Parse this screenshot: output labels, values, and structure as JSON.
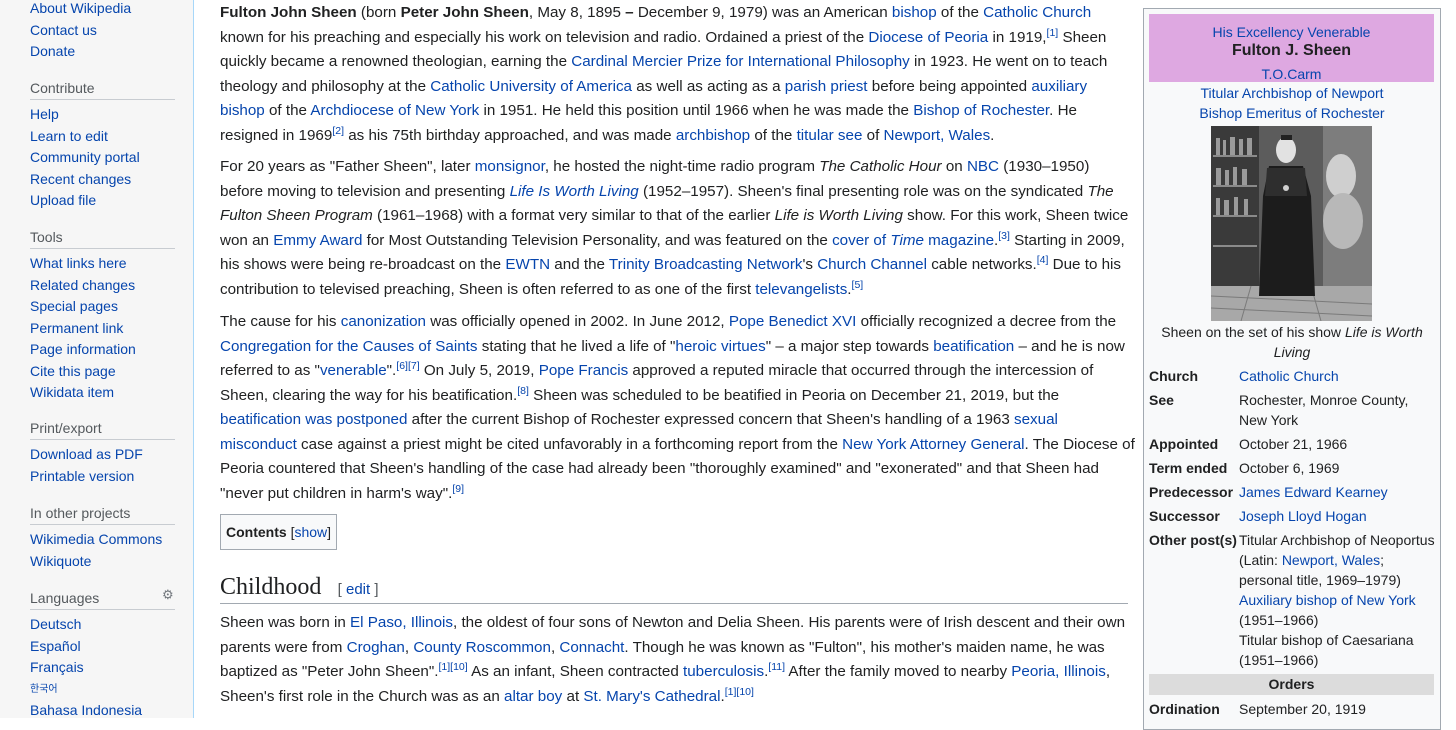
{
  "sidebar": {
    "top_links": [
      "About Wikipedia",
      "Contact us",
      "Donate"
    ],
    "contribute": {
      "heading": "Contribute",
      "links": [
        "Help",
        "Learn to edit",
        "Community portal",
        "Recent changes",
        "Upload file"
      ]
    },
    "tools": {
      "heading": "Tools",
      "links": [
        "What links here",
        "Related changes",
        "Special pages",
        "Permanent link",
        "Page information",
        "Cite this page",
        "Wikidata item"
      ]
    },
    "print": {
      "heading": "Print/export",
      "links": [
        "Download as PDF",
        "Printable version"
      ]
    },
    "projects": {
      "heading": "In other projects",
      "links": [
        "Wikimedia Commons",
        "Wikiquote"
      ]
    },
    "languages": {
      "heading": "Languages",
      "links": [
        "Deutsch",
        "Español",
        "Français",
        "한국어",
        "Bahasa Indonesia"
      ]
    }
  },
  "article": {
    "paragraphs": [
      [
        {
          "t": "Fulton John Sheen",
          "b": true
        },
        {
          "t": " (born "
        },
        {
          "t": "Peter John Sheen",
          "b": true
        },
        {
          "t": ", May 8, 1895 "
        },
        {
          "t": "–",
          "b": true
        },
        {
          "t": " December 9, 1979) was an American "
        },
        {
          "t": "bishop",
          "l": true
        },
        {
          "t": " of the "
        },
        {
          "t": "Catholic Church",
          "l": true
        },
        {
          "t": " known for his preaching and especially his work on television and radio. Ordained a priest of the "
        },
        {
          "t": "Diocese of Peoria",
          "l": true
        },
        {
          "t": " in 1919,"
        },
        {
          "t": "[1]",
          "s": true
        },
        {
          "t": " Sheen quickly became a renowned theologian, earning the "
        },
        {
          "t": "Cardinal Mercier Prize for International Philosophy",
          "l": true
        },
        {
          "t": " in 1923. He went on to teach theology and philosophy at the "
        },
        {
          "t": "Catholic University of America",
          "l": true
        },
        {
          "t": " as well as acting as a "
        },
        {
          "t": "parish priest",
          "l": true
        },
        {
          "t": " before being appointed "
        },
        {
          "t": "auxiliary bishop",
          "l": true
        },
        {
          "t": " of the "
        },
        {
          "t": "Archdiocese of New York",
          "l": true
        },
        {
          "t": " in 1951. He held this position until 1966 when he was made the "
        },
        {
          "t": "Bishop of Rochester",
          "l": true
        },
        {
          "t": ". He resigned in 1969"
        },
        {
          "t": "[2]",
          "s": true
        },
        {
          "t": " as his 75th birthday approached, and was made "
        },
        {
          "t": "archbishop",
          "l": true
        },
        {
          "t": " of the "
        },
        {
          "t": "titular see",
          "l": true
        },
        {
          "t": " of "
        },
        {
          "t": "Newport, Wales",
          "l": true
        },
        {
          "t": "."
        }
      ],
      [
        {
          "t": "For 20 years as \"Father Sheen\", later "
        },
        {
          "t": "monsignor",
          "l": true
        },
        {
          "t": ", he hosted the night-time radio program "
        },
        {
          "t": "The Catholic Hour",
          "i": true
        },
        {
          "t": " on "
        },
        {
          "t": "NBC",
          "l": true
        },
        {
          "t": " (1930–1950) before moving to television and presenting "
        },
        {
          "t": "Life Is Worth Living",
          "l": true,
          "i": true
        },
        {
          "t": " (1952–1957). Sheen's final presenting role was on the syndicated "
        },
        {
          "t": "The Fulton Sheen Program",
          "i": true
        },
        {
          "t": " (1961–1968) with a format very similar to that of the earlier "
        },
        {
          "t": "Life is Worth Living",
          "i": true
        },
        {
          "t": " show. For this work, Sheen twice won an "
        },
        {
          "t": "Emmy Award",
          "l": true
        },
        {
          "t": " for Most Outstanding Television Personality, and was featured on the "
        },
        {
          "t": "cover of ",
          "l": true
        },
        {
          "t": "Time",
          "l": true,
          "i": true
        },
        {
          "t": " magazine",
          "l": true
        },
        {
          "t": "."
        },
        {
          "t": "[3]",
          "s": true
        },
        {
          "t": " Starting in 2009, his shows were being re-broadcast on the "
        },
        {
          "t": "EWTN",
          "l": true
        },
        {
          "t": " and the "
        },
        {
          "t": "Trinity Broadcasting Network",
          "l": true
        },
        {
          "t": "'s "
        },
        {
          "t": "Church Channel",
          "l": true
        },
        {
          "t": " cable networks."
        },
        {
          "t": "[4]",
          "s": true
        },
        {
          "t": " Due to his contribution to televised preaching, Sheen is often referred to as one of the first "
        },
        {
          "t": "televangelists",
          "l": true
        },
        {
          "t": "."
        },
        {
          "t": "[5]",
          "s": true
        }
      ],
      [
        {
          "t": "The cause for his "
        },
        {
          "t": "canonization",
          "l": true
        },
        {
          "t": " was officially opened in 2002. In June 2012, "
        },
        {
          "t": "Pope Benedict XVI",
          "l": true
        },
        {
          "t": " officially recognized a decree from the "
        },
        {
          "t": "Congregation for the Causes of Saints",
          "l": true
        },
        {
          "t": " stating that he lived a life of \""
        },
        {
          "t": "heroic virtues",
          "l": true
        },
        {
          "t": "\" – a major step towards "
        },
        {
          "t": "beatification",
          "l": true
        },
        {
          "t": " – and he is now referred to as \""
        },
        {
          "t": "venerable",
          "l": true
        },
        {
          "t": "\"."
        },
        {
          "t": "[6][7]",
          "s": true
        },
        {
          "t": " On July 5, 2019, "
        },
        {
          "t": "Pope Francis",
          "l": true
        },
        {
          "t": " approved a reputed miracle that occurred through the intercession of Sheen, clearing the way for his beatification."
        },
        {
          "t": "[8]",
          "s": true
        },
        {
          "t": " Sheen was scheduled to be beatified in Peoria on December 21, 2019, but the "
        },
        {
          "t": "beatification was postponed",
          "l": true
        },
        {
          "t": " after the current Bishop of Rochester expressed concern that Sheen's handling of a 1963 "
        },
        {
          "t": "sexual misconduct",
          "l": true
        },
        {
          "t": " case against a priest might be cited unfavorably in a forthcoming report from the "
        },
        {
          "t": "New York Attorney General",
          "l": true
        },
        {
          "t": ". The Diocese of Peoria countered that Sheen's handling of the case had already been \"thoroughly examined\" and \"exonerated\" and that Sheen had \"never put children in harm's way\"."
        },
        {
          "t": "[9]",
          "s": true
        }
      ]
    ],
    "toc": {
      "title": "Contents",
      "open": "[",
      "toggle": "show",
      "close": "]"
    },
    "section": {
      "heading": "Childhood",
      "edit_open": "[",
      "edit_label": "edit",
      "edit_close": "]"
    },
    "section_paragraph": [
      {
        "t": "Sheen was born in "
      },
      {
        "t": "El Paso, Illinois",
        "l": true
      },
      {
        "t": ", the oldest of four sons of Newton and Delia Sheen. His parents were of Irish descent and their own parents were from "
      },
      {
        "t": "Croghan",
        "l": true
      },
      {
        "t": ", "
      },
      {
        "t": "County Roscommon",
        "l": true
      },
      {
        "t": ", "
      },
      {
        "t": "Connacht",
        "l": true
      },
      {
        "t": ". Though he was known as \"Fulton\", his mother's maiden name, he was baptized as \"Peter John Sheen\"."
      },
      {
        "t": "[1][10]",
        "s": true
      },
      {
        "t": " As an infant, Sheen contracted "
      },
      {
        "t": "tuberculosis",
        "l": true
      },
      {
        "t": "."
      },
      {
        "t": "[11]",
        "s": true
      },
      {
        "t": " After the family moved to nearby "
      },
      {
        "t": "Peoria, Illinois",
        "l": true
      },
      {
        "t": ", Sheen's first role in the Church was as an "
      },
      {
        "t": "altar boy",
        "l": true
      },
      {
        "t": " at "
      },
      {
        "t": "St. Mary's Cathedral",
        "l": true
      },
      {
        "t": "."
      },
      {
        "t": "[1][10]",
        "s": true
      }
    ]
  },
  "infobox": {
    "honorific": "His Excellency Venerable",
    "name": "Fulton J. Sheen",
    "postnominal": "T.O.Carm",
    "title1": "Titular Archbishop of Newport",
    "title2": "Bishop Emeritus of Rochester",
    "caption_prefix": "Sheen on the set of his show ",
    "caption_italic": "Life is Worth Living",
    "church_label": "Church",
    "church_value": "Catholic Church",
    "see_label": "See",
    "see_value": "Rochester, Monroe County, New York",
    "appointed_label": "Appointed",
    "appointed_value": "October 21, 1966",
    "ended_label": "Term ended",
    "ended_value": "October 6, 1969",
    "predecessor_label": "Predecessor",
    "predecessor_value": "James Edward Kearney",
    "successor_label": "Successor",
    "successor_value": "Joseph Lloyd Hogan",
    "other_label": "Other post(s)",
    "other_1": "Titular Archbishop of Neoportus",
    "other_2a": "(Latin: ",
    "other_2_link": "Newport, Wales",
    "other_2b": ";",
    "other_3": "personal title, 1969–1979)",
    "other_4": "Auxiliary bishop of New York",
    "other_5": "(1951–1966)",
    "other_6": "Titular bishop of Caesariana",
    "other_7": "(1951–1966)",
    "orders_heading": "Orders",
    "ordination_label": "Ordination",
    "ordination_value": "September 20, 1919"
  }
}
